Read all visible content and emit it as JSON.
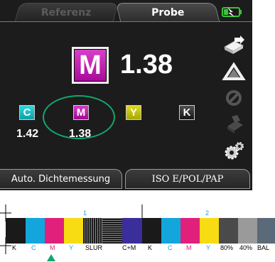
{
  "tabs": [
    {
      "label": "Referenz",
      "active": false
    },
    {
      "label": "Probe",
      "active": true
    }
  ],
  "main": {
    "patch_letter": "M",
    "value": "1.38",
    "patch_color": "#c020b0"
  },
  "channels": [
    {
      "letter": "C",
      "value": "1.42",
      "color": "#10b8c0"
    },
    {
      "letter": "M",
      "value": "1.38",
      "color": "#c020b0"
    },
    {
      "letter": "Y",
      "value": "",
      "color": "#c0c010"
    },
    {
      "letter": "K",
      "value": "",
      "color": "#222222"
    }
  ],
  "highlight_color": "#12a86e",
  "side_icons": [
    "transfer-icon",
    "triangle-icon",
    "disabled-no-icon",
    "disabled-stack-icon",
    "gears-icon"
  ],
  "buttons": {
    "auto": "Auto. Dichtemessung",
    "iso": "ISO E/POL/PAP"
  },
  "colorbar": {
    "group_numbers": [
      "1",
      "2"
    ],
    "labels": [
      "K",
      "C",
      "M",
      "Y",
      "SLUR",
      "C+M",
      "K",
      "C",
      "M",
      "Y",
      "80%",
      "40%",
      "BAL"
    ]
  }
}
